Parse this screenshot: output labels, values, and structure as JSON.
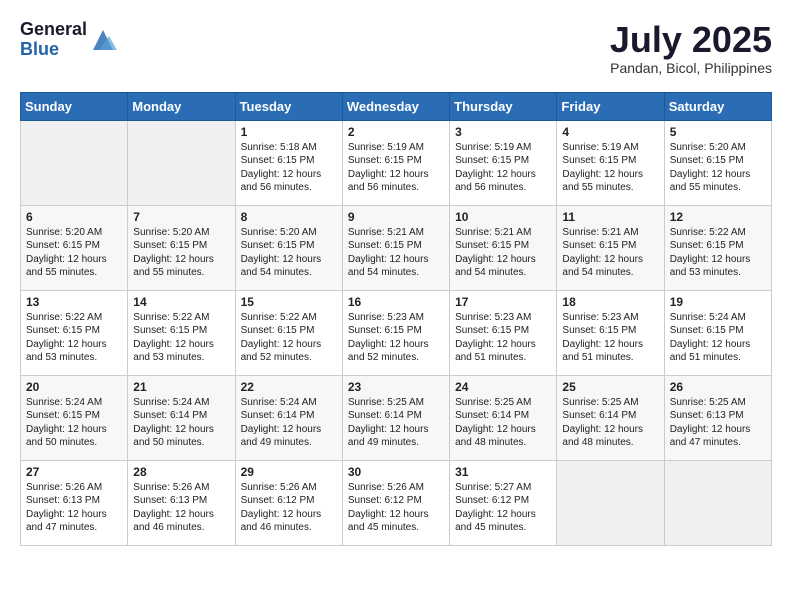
{
  "header": {
    "logo_general": "General",
    "logo_blue": "Blue",
    "month_year": "July 2025",
    "location": "Pandan, Bicol, Philippines"
  },
  "weekdays": [
    "Sunday",
    "Monday",
    "Tuesday",
    "Wednesday",
    "Thursday",
    "Friday",
    "Saturday"
  ],
  "weeks": [
    [
      {
        "day": "",
        "info": ""
      },
      {
        "day": "",
        "info": ""
      },
      {
        "day": "1",
        "info": "Sunrise: 5:18 AM\nSunset: 6:15 PM\nDaylight: 12 hours\nand 56 minutes."
      },
      {
        "day": "2",
        "info": "Sunrise: 5:19 AM\nSunset: 6:15 PM\nDaylight: 12 hours\nand 56 minutes."
      },
      {
        "day": "3",
        "info": "Sunrise: 5:19 AM\nSunset: 6:15 PM\nDaylight: 12 hours\nand 56 minutes."
      },
      {
        "day": "4",
        "info": "Sunrise: 5:19 AM\nSunset: 6:15 PM\nDaylight: 12 hours\nand 55 minutes."
      },
      {
        "day": "5",
        "info": "Sunrise: 5:20 AM\nSunset: 6:15 PM\nDaylight: 12 hours\nand 55 minutes."
      }
    ],
    [
      {
        "day": "6",
        "info": "Sunrise: 5:20 AM\nSunset: 6:15 PM\nDaylight: 12 hours\nand 55 minutes."
      },
      {
        "day": "7",
        "info": "Sunrise: 5:20 AM\nSunset: 6:15 PM\nDaylight: 12 hours\nand 55 minutes."
      },
      {
        "day": "8",
        "info": "Sunrise: 5:20 AM\nSunset: 6:15 PM\nDaylight: 12 hours\nand 54 minutes."
      },
      {
        "day": "9",
        "info": "Sunrise: 5:21 AM\nSunset: 6:15 PM\nDaylight: 12 hours\nand 54 minutes."
      },
      {
        "day": "10",
        "info": "Sunrise: 5:21 AM\nSunset: 6:15 PM\nDaylight: 12 hours\nand 54 minutes."
      },
      {
        "day": "11",
        "info": "Sunrise: 5:21 AM\nSunset: 6:15 PM\nDaylight: 12 hours\nand 54 minutes."
      },
      {
        "day": "12",
        "info": "Sunrise: 5:22 AM\nSunset: 6:15 PM\nDaylight: 12 hours\nand 53 minutes."
      }
    ],
    [
      {
        "day": "13",
        "info": "Sunrise: 5:22 AM\nSunset: 6:15 PM\nDaylight: 12 hours\nand 53 minutes."
      },
      {
        "day": "14",
        "info": "Sunrise: 5:22 AM\nSunset: 6:15 PM\nDaylight: 12 hours\nand 53 minutes."
      },
      {
        "day": "15",
        "info": "Sunrise: 5:22 AM\nSunset: 6:15 PM\nDaylight: 12 hours\nand 52 minutes."
      },
      {
        "day": "16",
        "info": "Sunrise: 5:23 AM\nSunset: 6:15 PM\nDaylight: 12 hours\nand 52 minutes."
      },
      {
        "day": "17",
        "info": "Sunrise: 5:23 AM\nSunset: 6:15 PM\nDaylight: 12 hours\nand 51 minutes."
      },
      {
        "day": "18",
        "info": "Sunrise: 5:23 AM\nSunset: 6:15 PM\nDaylight: 12 hours\nand 51 minutes."
      },
      {
        "day": "19",
        "info": "Sunrise: 5:24 AM\nSunset: 6:15 PM\nDaylight: 12 hours\nand 51 minutes."
      }
    ],
    [
      {
        "day": "20",
        "info": "Sunrise: 5:24 AM\nSunset: 6:15 PM\nDaylight: 12 hours\nand 50 minutes."
      },
      {
        "day": "21",
        "info": "Sunrise: 5:24 AM\nSunset: 6:14 PM\nDaylight: 12 hours\nand 50 minutes."
      },
      {
        "day": "22",
        "info": "Sunrise: 5:24 AM\nSunset: 6:14 PM\nDaylight: 12 hours\nand 49 minutes."
      },
      {
        "day": "23",
        "info": "Sunrise: 5:25 AM\nSunset: 6:14 PM\nDaylight: 12 hours\nand 49 minutes."
      },
      {
        "day": "24",
        "info": "Sunrise: 5:25 AM\nSunset: 6:14 PM\nDaylight: 12 hours\nand 48 minutes."
      },
      {
        "day": "25",
        "info": "Sunrise: 5:25 AM\nSunset: 6:14 PM\nDaylight: 12 hours\nand 48 minutes."
      },
      {
        "day": "26",
        "info": "Sunrise: 5:25 AM\nSunset: 6:13 PM\nDaylight: 12 hours\nand 47 minutes."
      }
    ],
    [
      {
        "day": "27",
        "info": "Sunrise: 5:26 AM\nSunset: 6:13 PM\nDaylight: 12 hours\nand 47 minutes."
      },
      {
        "day": "28",
        "info": "Sunrise: 5:26 AM\nSunset: 6:13 PM\nDaylight: 12 hours\nand 46 minutes."
      },
      {
        "day": "29",
        "info": "Sunrise: 5:26 AM\nSunset: 6:12 PM\nDaylight: 12 hours\nand 46 minutes."
      },
      {
        "day": "30",
        "info": "Sunrise: 5:26 AM\nSunset: 6:12 PM\nDaylight: 12 hours\nand 45 minutes."
      },
      {
        "day": "31",
        "info": "Sunrise: 5:27 AM\nSunset: 6:12 PM\nDaylight: 12 hours\nand 45 minutes."
      },
      {
        "day": "",
        "info": ""
      },
      {
        "day": "",
        "info": ""
      }
    ]
  ]
}
